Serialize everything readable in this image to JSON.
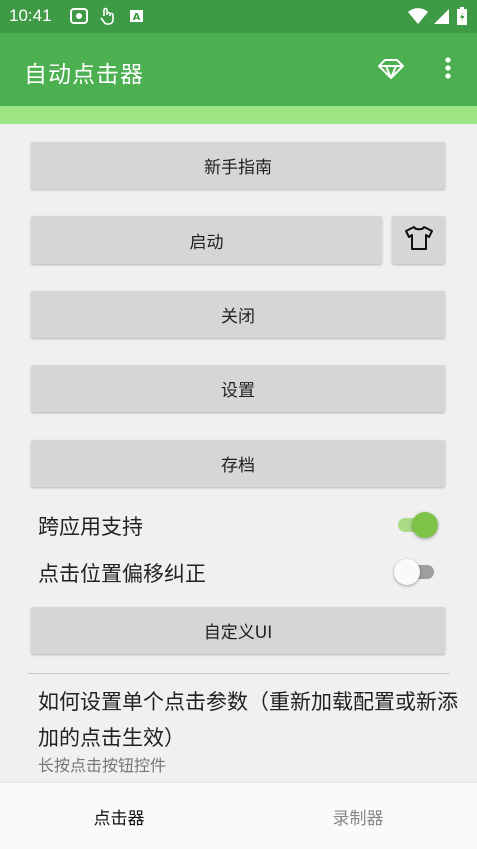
{
  "status_bar": {
    "time": "10:41",
    "icons": [
      "notification-image-icon",
      "touch-hand-icon",
      "text-a-icon",
      "wifi-icon",
      "signal-icon",
      "battery-icon"
    ]
  },
  "app_bar": {
    "title": "自动点击器",
    "actions": [
      "diamond-icon",
      "more-vert-icon"
    ]
  },
  "colors": {
    "status_bar": "#3f9a45",
    "app_bar": "#4caf50",
    "progress_strip": "#9de483",
    "switch_on": "#7cc347",
    "switch_on_track": "#a9db86",
    "switch_off": "#fafafa",
    "switch_off_track": "#9e9e9e"
  },
  "buttons": {
    "guide": "新手指南",
    "start": "启动",
    "start_side_icon": "tshirt-icon",
    "close": "关闭",
    "settings": "设置",
    "save": "存档",
    "custom_ui": "自定义UI"
  },
  "toggles": [
    {
      "label": "跨应用支持",
      "on": true
    },
    {
      "label": "点击位置偏移纠正",
      "on": false
    }
  ],
  "help": {
    "title": "如何设置单个点击参数（重新加载配置或新添加的点击生效）",
    "subtitle": "长按点击按钮控件"
  },
  "bottom_nav": {
    "items": [
      {
        "label": "点击器",
        "active": true
      },
      {
        "label": "录制器",
        "active": false
      }
    ]
  }
}
